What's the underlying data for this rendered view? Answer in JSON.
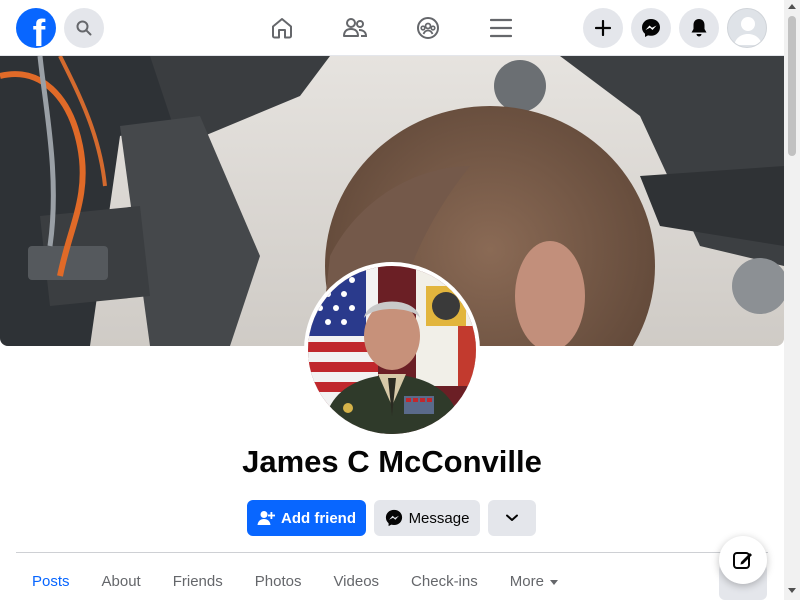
{
  "app": {
    "brand_glyph": "f",
    "accent": "#0866ff"
  },
  "topbar": {
    "icons": [
      "search-icon",
      "home-icon",
      "friends-icon",
      "groups-icon",
      "menu-icon",
      "plus-icon",
      "messenger-icon",
      "bell-icon",
      "account-avatar"
    ]
  },
  "profile": {
    "name": "James C McConville"
  },
  "actions": {
    "add_friend": "Add friend",
    "message": "Message"
  },
  "tabs": [
    {
      "label": "Posts",
      "active": true
    },
    {
      "label": "About"
    },
    {
      "label": "Friends"
    },
    {
      "label": "Photos"
    },
    {
      "label": "Videos"
    },
    {
      "label": "Check-ins"
    },
    {
      "label": "More"
    }
  ],
  "colors": {
    "primary": "#0866ff",
    "secondary_bg": "#e4e6eb",
    "muted_text": "#65676b"
  }
}
